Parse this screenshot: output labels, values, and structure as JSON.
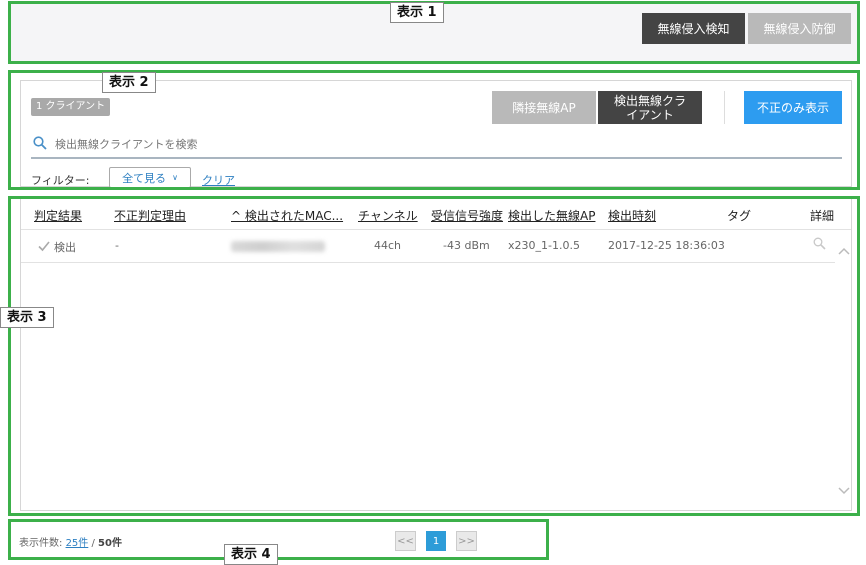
{
  "callouts": {
    "c1": "表示 1",
    "c2": "表示 2",
    "c3": "表示 3",
    "c4": "表示 4"
  },
  "top_tabs": {
    "ids_label": "無線侵入検知",
    "ips_label": "無線侵入防御"
  },
  "toolbar": {
    "client_count_badge": "1 クライアント",
    "neighbor_ap_label": "隣接無線AP",
    "detected_client_label": "検出無線クライアント",
    "rogue_only_label": "不正のみ表示",
    "search_placeholder": "検出無線クライアントを検索",
    "filter_label": "フィルター:",
    "filter_value": "全て見る",
    "filter_clear": "クリア"
  },
  "table": {
    "headers": [
      "判定結果",
      "不正判定理由",
      "^ 検出されたMAC...",
      "チャンネル",
      "受信信号強度",
      "検出した無線AP",
      "検出時刻",
      "タグ",
      "詳細"
    ],
    "rows": [
      {
        "result": "検出",
        "reason": "-",
        "channel": "44ch",
        "rssi": "-43 dBm",
        "ap": "x230_1-1.0.5",
        "time": "2017-12-25 18:36:03"
      }
    ]
  },
  "pagination": {
    "count_label": "表示件数:",
    "page_size": "25件",
    "separator": " / ",
    "total": "50件",
    "prev": "<<",
    "current": "1",
    "next": ">>"
  },
  "colors": {
    "annotation_border": "#3cb04a",
    "primary_blue": "#2d9cf0",
    "active_dark": "#444444",
    "inactive_gray": "#b9b9b9"
  }
}
